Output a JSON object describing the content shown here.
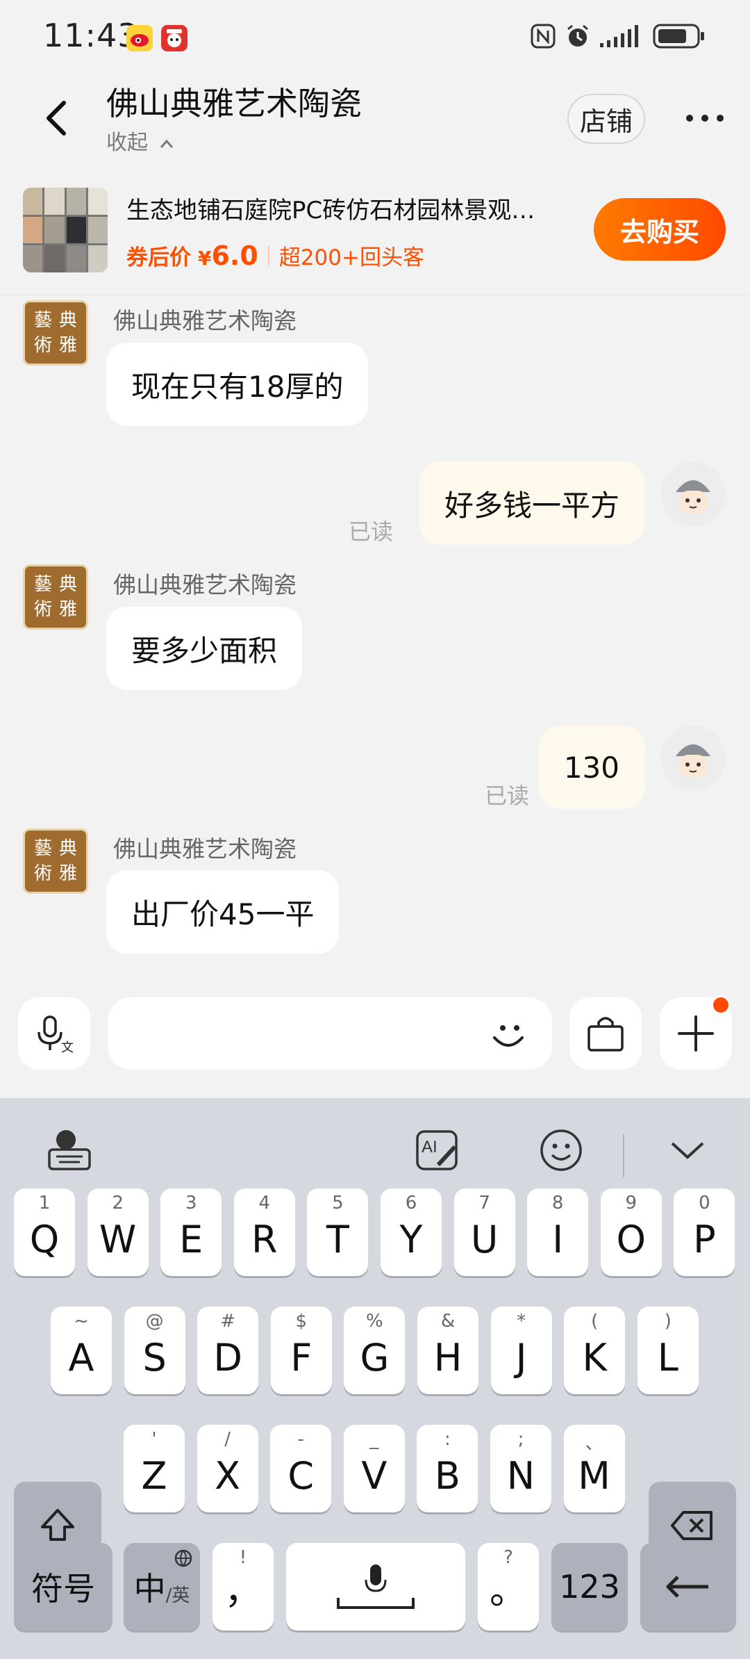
{
  "status_bar": {
    "time": "11:43",
    "icons": [
      "weibo-icon",
      "mascot-app-icon",
      "nfc-icon",
      "alarm-icon",
      "signal-icon",
      "battery-icon"
    ]
  },
  "header": {
    "shop_name": "佛山典雅艺术陶瓷",
    "collapse_label": "收起",
    "store_button": "店铺"
  },
  "product": {
    "title": "生态地铺石庭院PC砖仿石材园林景观…",
    "price_label": "券后价",
    "currency": "¥",
    "price": "6.0",
    "repeat_customers": "超200+回头客",
    "buy_button": "去购买"
  },
  "shop_avatar_text": [
    "藝",
    "典",
    "術",
    "雅"
  ],
  "messages": [
    {
      "from": "shop",
      "sender": "佛山典雅艺术陶瓷",
      "text": "现在只有18厚的"
    },
    {
      "from": "me",
      "text": "好多钱一平方",
      "status": "已读"
    },
    {
      "from": "shop",
      "sender": "佛山典雅艺术陶瓷",
      "text": "要多少面积"
    },
    {
      "from": "me",
      "text": "130",
      "status": "已读"
    },
    {
      "from": "shop",
      "sender": "佛山典雅艺术陶瓷",
      "text": "出厂价45一平"
    }
  ],
  "keyboard": {
    "row1": [
      [
        "1",
        "Q"
      ],
      [
        "2",
        "W"
      ],
      [
        "3",
        "E"
      ],
      [
        "4",
        "R"
      ],
      [
        "5",
        "T"
      ],
      [
        "6",
        "Y"
      ],
      [
        "7",
        "U"
      ],
      [
        "8",
        "I"
      ],
      [
        "9",
        "O"
      ],
      [
        "0",
        "P"
      ]
    ],
    "row2": [
      [
        "~",
        "A"
      ],
      [
        "@",
        "S"
      ],
      [
        "#",
        "D"
      ],
      [
        "$",
        "F"
      ],
      [
        "%",
        "G"
      ],
      [
        "&",
        "H"
      ],
      [
        "*",
        "J"
      ],
      [
        "(",
        "K"
      ],
      [
        ")",
        "L"
      ]
    ],
    "row3": [
      [
        "'",
        "Z"
      ],
      [
        "/",
        "X"
      ],
      [
        "-",
        "C"
      ],
      [
        "_",
        "V"
      ],
      [
        ":",
        "B"
      ],
      [
        ";",
        "N"
      ],
      [
        "、",
        "M"
      ]
    ],
    "symbols_label": "符号",
    "lang_label_main": "中",
    "lang_label_sub": "/英",
    "comma": "，",
    "comma_hint": "!",
    "period": "。",
    "period_hint": "?",
    "numbers_label": "123"
  },
  "colors": {
    "accent": "#ff5000",
    "bubble_out": "#fef9ec",
    "bubble_in": "#ffffff",
    "background": "#f2f2f2",
    "keyboard_bg": "#d6d8e0"
  }
}
